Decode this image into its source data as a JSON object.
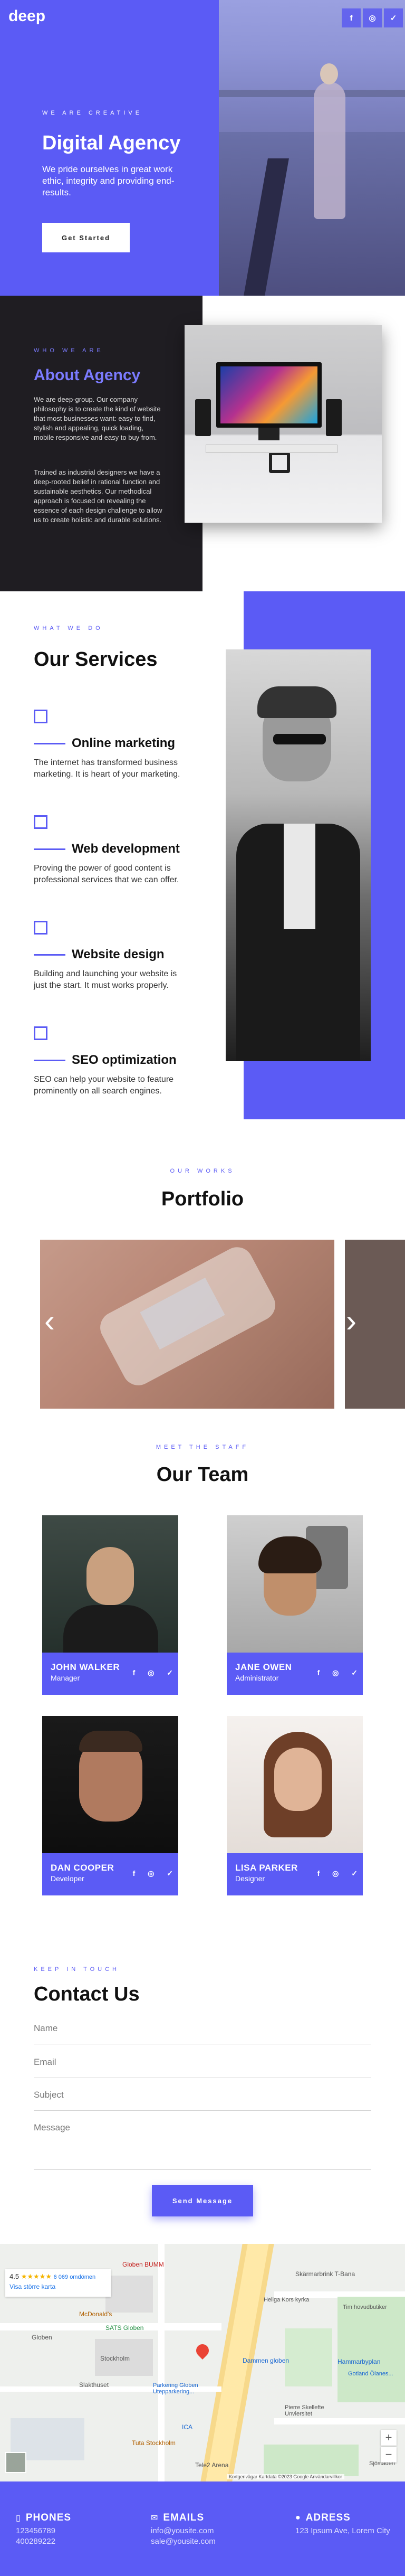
{
  "nav": {
    "logo": "deep",
    "socials": [
      {
        "name": "facebook-icon",
        "glyph": "f"
      },
      {
        "name": "instagram-icon",
        "glyph": "◎"
      },
      {
        "name": "twitter-icon",
        "glyph": "✓"
      }
    ]
  },
  "hero": {
    "eyebrow": "WE ARE CREATIVE",
    "title": "Digital Agency",
    "text": "We pride ourselves in great work ethic, integrity and providing end-results.",
    "cta": "Get Started"
  },
  "about": {
    "eyebrow": "WHO WE ARE",
    "title": "About Agency",
    "para1": "We are deep-group. Our company philosophy is to create the kind of website that most businesses want: easy to find, stylish and appealing, quick loading, mobile responsive and easy to buy from.",
    "para2": "Trained as industrial designers we have a deep-rooted belief in rational function and sustainable aesthetics. Our methodical approach is focused on revealing the essence of each design challenge to allow us to create holistic and durable solutions."
  },
  "services": {
    "eyebrow": "WHAT WE DO",
    "title": "Our Services",
    "items": [
      {
        "title": "Online marketing",
        "text": "The internet has transformed business marketing. It is heart of your marketing."
      },
      {
        "title": "Web development",
        "text": "Proving the power of good content is professional services that we can offer."
      },
      {
        "title": "Website design",
        "text": "Building and launching your website is just the start. It must works properly."
      },
      {
        "title": "SEO optimization",
        "text": "SEO can help your website to feature prominently on all search engines."
      }
    ]
  },
  "portfolio": {
    "eyebrow": "OUR WORKS",
    "title": "Portfolio",
    "prev_glyph": "‹",
    "next_glyph": "›"
  },
  "team": {
    "eyebrow": "MEET THE STAFF",
    "title": "Our Team",
    "members": [
      {
        "name": "JOHN WALKER",
        "role": "Manager"
      },
      {
        "name": "JANE OWEN",
        "role": "Administrator"
      },
      {
        "name": "DAN COOPER",
        "role": "Developer"
      },
      {
        "name": "LISA PARKER",
        "role": "Designer"
      }
    ],
    "icons": "f ◎ ✓"
  },
  "contact": {
    "eyebrow": "KEEP IN TOUCH",
    "title": "Contact Us",
    "fields": {
      "name": "Name",
      "email": "Email",
      "subject": "Subject",
      "message": "Message"
    },
    "send": "Send Message"
  },
  "map": {
    "rating": "4.5",
    "stars": "★★★★★",
    "reviews": "6 069 omdömen",
    "larger_map": "Visa större karta",
    "labels": {
      "globen_bumm": "Globen BUMM",
      "globen": "Globen",
      "mcdonalds": "McDonald's",
      "sats": "SATS Globen",
      "parkering": "Parkering Globen Utepparkering...",
      "stockholm": "Stockholm",
      "slakthuset": "Slakthuset",
      "ica": "ICA",
      "tele2": "Tele2 Arena",
      "tuta": "Tuta Stockholm",
      "dammen": "Dammen globen",
      "skarmarbrink": "Skärmarbrink T-Bana",
      "heliga": "Heliga Kors kyrka",
      "tim": "Tim hovudbutiker",
      "hammarbyplan": "Hammarbyplan",
      "gotland": "Gotland Ölanes...",
      "pierre": "Pierre Skellefte Unviersitet",
      "sjostaden": "Sjöstaden"
    },
    "footer_text": "Kortgenvägar  Kartdata ©2023 Google  Användarvillkor",
    "zoom_in": "+",
    "zoom_out": "−"
  },
  "footer": {
    "phones": {
      "title": "PHONES",
      "lines": [
        "123456789",
        "400289222"
      ]
    },
    "emails": {
      "title": "EMAILS",
      "lines": [
        "info@yousite.com",
        "sale@yousite.com"
      ]
    },
    "address": {
      "title": "ADRESS",
      "lines": [
        "123 Ipsum Ave, Lorem City"
      ]
    }
  },
  "colors": {
    "accent": "#5b5bf5",
    "dark": "#1f1d22"
  }
}
